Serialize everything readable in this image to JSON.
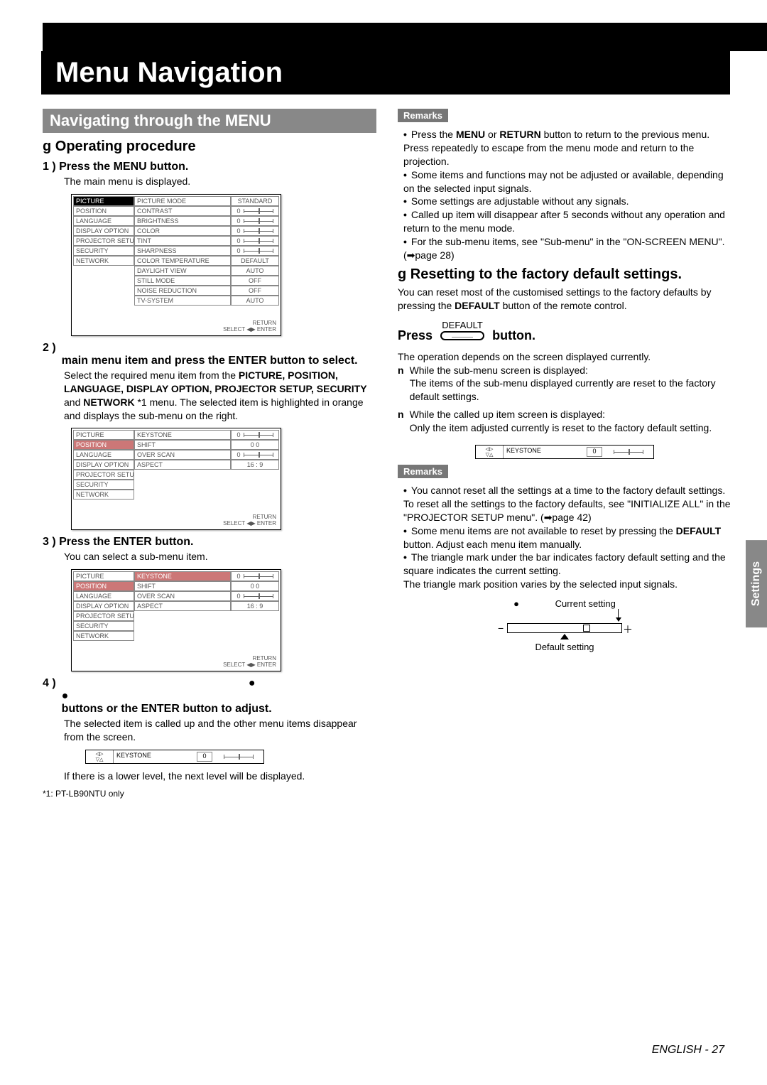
{
  "title": "Menu Navigation",
  "sectionBar": "Navigating through the MENU",
  "opProcHeading": "g  Operating procedure",
  "step1": {
    "heading": "1 ) Press the MENU button.",
    "body": "The main menu is displayed.",
    "menu": {
      "left": [
        "PICTURE",
        "POSITION",
        "LANGUAGE",
        "DISPLAY OPTION",
        "PROJECTOR SETUP",
        "SECURITY",
        "NETWORK"
      ],
      "leftDarkIndex": 0,
      "rows": [
        {
          "label": "PICTURE MODE",
          "val": "STANDARD",
          "slider": false
        },
        {
          "label": "CONTRAST",
          "val": "0",
          "slider": true
        },
        {
          "label": "BRIGHTNESS",
          "val": "0",
          "slider": true
        },
        {
          "label": "COLOR",
          "val": "0",
          "slider": true
        },
        {
          "label": "TINT",
          "val": "0",
          "slider": true
        },
        {
          "label": "SHARPNESS",
          "val": "0",
          "slider": true
        },
        {
          "label": "COLOR TEMPERATURE",
          "val": "DEFAULT",
          "slider": false
        },
        {
          "label": "DAYLIGHT VIEW",
          "val": "AUTO",
          "slider": false
        },
        {
          "label": "STILL MODE",
          "val": "OFF",
          "slider": false
        },
        {
          "label": "NOISE REDUCTION",
          "val": "OFF",
          "slider": false
        },
        {
          "label": "TV-SYSTEM",
          "val": "AUTO",
          "slider": false
        }
      ],
      "returnLabel": "RETURN",
      "selectLabel": "SELECT",
      "enterLabel": "ENTER"
    }
  },
  "step2": {
    "num": "2 )",
    "headingRest": "main menu item and press the ENTER button to select.",
    "body": "Select the required menu item from the ",
    "bold": "PICTURE, POSITION, LANGUAGE, DISPLAY OPTION, PROJECTOR SETUP, SECURITY",
    "body2a": " and ",
    "body2b": "NETWORK",
    "body2c": " *1 menu. The selected item is highlighted in orange and displays the sub-menu on the right.",
    "menu": {
      "left": [
        "PICTURE",
        "POSITION",
        "LANGUAGE",
        "DISPLAY OPTION",
        "PROJECTOR SETUP",
        "SECURITY",
        "NETWORK"
      ],
      "hlIndex": 1,
      "rows": [
        {
          "label": "KEYSTONE",
          "val": "0",
          "slider": true
        },
        {
          "label": "SHIFT",
          "val": "0   0",
          "slider": false
        },
        {
          "label": "OVER SCAN",
          "val": "0",
          "slider": true
        },
        {
          "label": "ASPECT",
          "val": "16 : 9",
          "slider": false
        }
      ]
    }
  },
  "step3": {
    "heading": "3 ) Press the ENTER button.",
    "body": "You can select a sub-menu item.",
    "menu": {
      "left": [
        "PICTURE",
        "POSITION",
        "LANGUAGE",
        "DISPLAY OPTION",
        "PROJECTOR SETUP",
        "SECURITY",
        "NETWORK"
      ],
      "hlIndex": 1,
      "rows": [
        {
          "label": "KEYSTONE",
          "val": "0",
          "slider": true,
          "hl": true
        },
        {
          "label": "SHIFT",
          "val": "0   0",
          "slider": false
        },
        {
          "label": "OVER SCAN",
          "val": "0",
          "slider": true
        },
        {
          "label": "ASPECT",
          "val": "16 : 9",
          "slider": false
        }
      ]
    }
  },
  "step4": {
    "num": "4 )",
    "headingBold": "buttons or the ENTER button to adjust.",
    "body": "The selected item is called up and the other menu items disappear from the screen.",
    "keystone": {
      "label": "KEYSTONE",
      "val": "0"
    },
    "body2": "If there is a lower level, the next level will be displayed."
  },
  "footnote": "*1: PT-LB90NTU only",
  "remarksLabel": "Remarks",
  "remarks1": [
    "Press the MENU or RETURN button to return to the previous menu. Press repeatedly to escape from the menu mode and return to the projection.",
    "Some items and functions may not be adjusted or available, depending on the selected input signals.",
    "Some settings are adjustable without any signals.",
    "Called up item will disappear after 5 seconds without any operation and return to the menu mode.",
    "For the sub-menu items, see \"Sub-menu\" in the \"ON-SCREEN MENU\". (➡page 28)"
  ],
  "remarks1bold": {
    "0": [
      "MENU",
      "RETURN"
    ]
  },
  "resetHeading": "g  Resetting to the factory default settings.",
  "resetBody": "You can reset most of the customised settings to the factory defaults by pressing the DEFAULT button of the remote control.",
  "resetBoldWord": "DEFAULT",
  "pressLine": {
    "pre": "Press",
    "btnTop": "DEFAULT",
    "post": "button."
  },
  "resetAfter": "The operation depends on the screen displayed currently.",
  "nlist": [
    {
      "mark": "n",
      "text": "While the sub-menu screen is displayed:\nThe items of the sub-menu displayed currently are reset to the factory default settings."
    },
    {
      "mark": "n",
      "text": "While the called up item screen is displayed:\nOnly the item adjusted currently is reset to the factory default setting."
    }
  ],
  "keystoneStrip2": {
    "label": "KEYSTONE",
    "val": "0"
  },
  "remarks2": [
    "You cannot reset all the settings at a time to the factory default settings.\nTo reset all the settings to the factory defaults, see \"INITIALIZE ALL\" in the \"PROJECTOR SETUP menu\". (➡page 42)",
    "Some menu items are not available to reset by pressing the DEFAULT button. Adjust each menu item manually.",
    "The triangle mark under the bar indicates factory default setting and the square indicates the current setting.\nThe triangle mark position varies by the selected input signals."
  ],
  "remarks2bold": {
    "1": [
      "DEFAULT"
    ]
  },
  "diag": {
    "current": "Current setting",
    "default": "Default setting"
  },
  "sideTab": "Settings",
  "footer": {
    "lang": "ENGLISH",
    "page": "27",
    "sep": " - "
  }
}
